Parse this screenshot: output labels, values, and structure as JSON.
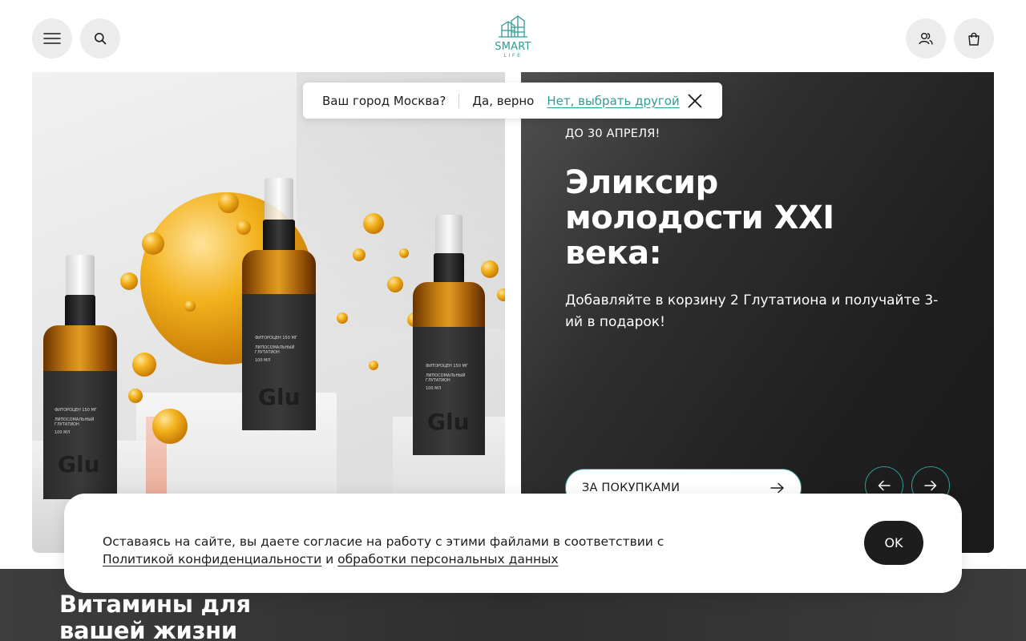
{
  "header": {
    "logo_text": "SMART",
    "logo_subtext": "LIFE",
    "brand_color": "#2f9c95",
    "icons": [
      "menu-icon",
      "search-icon",
      "user-icon",
      "cart-icon"
    ]
  },
  "city_popup": {
    "question": "Ваш город",
    "city": "Москва?",
    "yes_label": "Да, верно",
    "no_label": "Нет, выбрать другой"
  },
  "promo": {
    "date": "ДО 30 АПРЕЛЯ!",
    "title": "Эликсир молодости XXI века:",
    "description": "Добавляйте в корзину 2 Глутатиона и получайте 3-ий в подарок!",
    "button_label": "ЗА ПОКУПКАМИ"
  },
  "product_image": {
    "bottle_text": "Glu",
    "label_name": "ЛИПОСОМАЛЬНЫЙ ГЛУТАТИОН",
    "label_top": "ФИТОРОЦЕН 150 МГ",
    "label_volume": "100 МЛ"
  },
  "cookie": {
    "text": "Оставаясь на сайте, вы даете согласие на работу с этими файлами в соответствии с",
    "link1": "Политикой конфиденциальности",
    "and": "и",
    "link2": "обработки персональных данных",
    "ok_label": "OK"
  },
  "section": {
    "title": "Витамины для вашей жизни"
  }
}
